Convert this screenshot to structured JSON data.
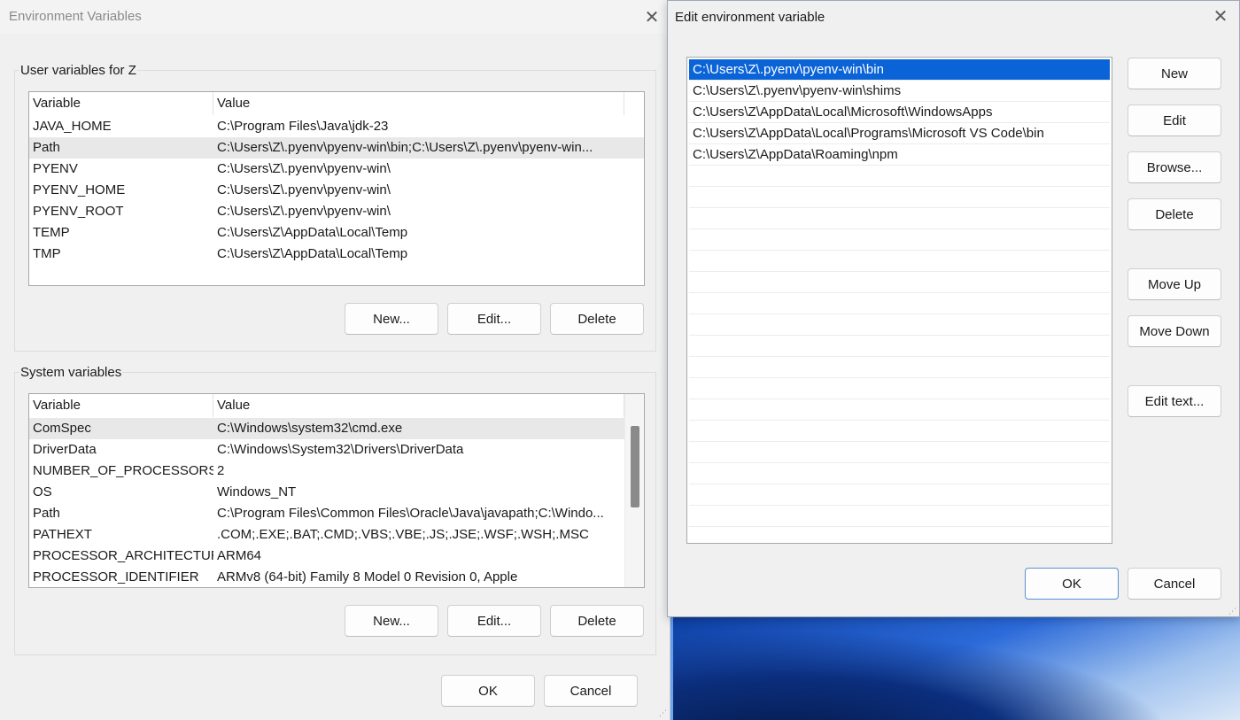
{
  "env_window": {
    "title": "Environment Variables",
    "user_group": {
      "label": "User variables for Z",
      "col_variable": "Variable",
      "col_value": "Value",
      "rows": [
        {
          "name": "JAVA_HOME",
          "value": "C:\\Program Files\\Java\\jdk-23"
        },
        {
          "name": "Path",
          "value": "C:\\Users\\Z\\.pyenv\\pyenv-win\\bin;C:\\Users\\Z\\.pyenv\\pyenv-win..."
        },
        {
          "name": "PYENV",
          "value": "C:\\Users\\Z\\.pyenv\\pyenv-win\\"
        },
        {
          "name": "PYENV_HOME",
          "value": "C:\\Users\\Z\\.pyenv\\pyenv-win\\"
        },
        {
          "name": "PYENV_ROOT",
          "value": "C:\\Users\\Z\\.pyenv\\pyenv-win\\"
        },
        {
          "name": "TEMP",
          "value": "C:\\Users\\Z\\AppData\\Local\\Temp"
        },
        {
          "name": "TMP",
          "value": "C:\\Users\\Z\\AppData\\Local\\Temp"
        }
      ],
      "selected_index": 1,
      "new_label": "New...",
      "edit_label": "Edit...",
      "delete_label": "Delete"
    },
    "system_group": {
      "label": "System variables",
      "col_variable": "Variable",
      "col_value": "Value",
      "rows": [
        {
          "name": "ComSpec",
          "value": "C:\\Windows\\system32\\cmd.exe"
        },
        {
          "name": "DriverData",
          "value": "C:\\Windows\\System32\\Drivers\\DriverData"
        },
        {
          "name": "NUMBER_OF_PROCESSORS",
          "value": "2"
        },
        {
          "name": "OS",
          "value": "Windows_NT"
        },
        {
          "name": "Path",
          "value": "C:\\Program Files\\Common Files\\Oracle\\Java\\javapath;C:\\Windo..."
        },
        {
          "name": "PATHEXT",
          "value": ".COM;.EXE;.BAT;.CMD;.VBS;.VBE;.JS;.JSE;.WSF;.WSH;.MSC"
        },
        {
          "name": "PROCESSOR_ARCHITECTURE",
          "value": "ARM64"
        },
        {
          "name": "PROCESSOR_IDENTIFIER",
          "value": "ARMv8 (64-bit) Family 8 Model 0 Revision   0, Apple"
        }
      ],
      "selected_index": 0,
      "new_label": "New...",
      "edit_label": "Edit...",
      "delete_label": "Delete"
    },
    "ok_label": "OK",
    "cancel_label": "Cancel"
  },
  "edit_window": {
    "title": "Edit environment variable",
    "entries": [
      "C:\\Users\\Z\\.pyenv\\pyenv-win\\bin",
      "C:\\Users\\Z\\.pyenv\\pyenv-win\\shims",
      "C:\\Users\\Z\\AppData\\Local\\Microsoft\\WindowsApps",
      "C:\\Users\\Z\\AppData\\Local\\Programs\\Microsoft VS Code\\bin",
      "C:\\Users\\Z\\AppData\\Roaming\\npm"
    ],
    "selected_index": 0,
    "empty_rows": 18,
    "buttons": {
      "new": "New",
      "edit": "Edit",
      "browse": "Browse...",
      "delete": "Delete",
      "move_up": "Move Up",
      "move_down": "Move Down",
      "edit_text": "Edit text...",
      "ok": "OK",
      "cancel": "Cancel"
    }
  },
  "icons": {
    "close": "close-icon",
    "resize": "resize-grip-icon"
  },
  "colors": {
    "selection_blue": "#0a64d8",
    "row_highlight": "#e8e8e8",
    "window_bg": "#f0f0f0"
  }
}
